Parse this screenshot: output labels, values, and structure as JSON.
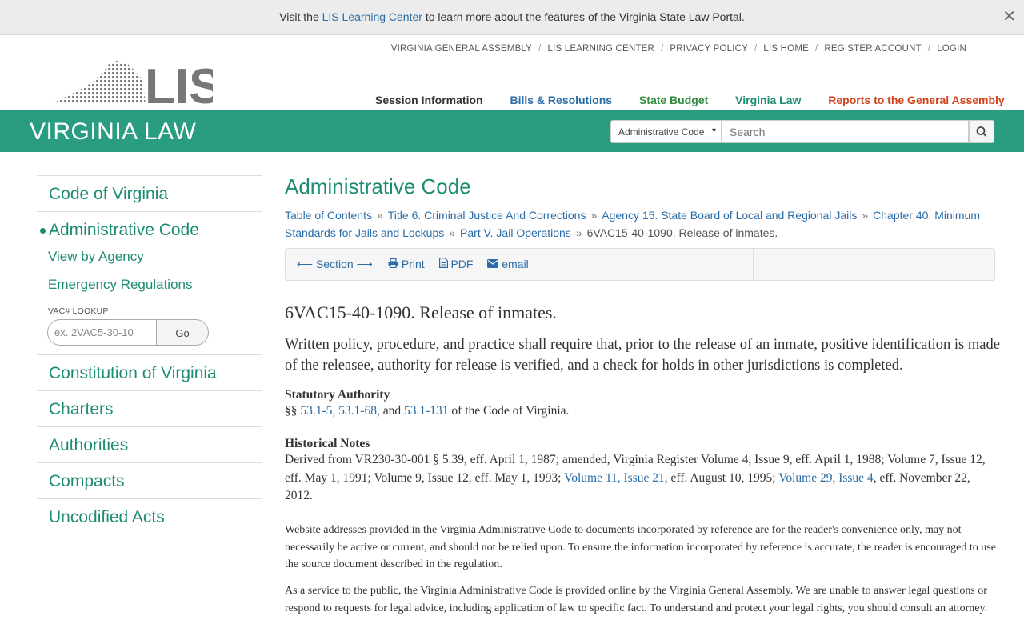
{
  "notice": {
    "prefix": "Visit the",
    "link": "LIS Learning Center",
    "suffix": "to learn more about the features of the Virginia State Law Portal.",
    "close": "✕"
  },
  "utility_links": [
    "VIRGINIA GENERAL ASSEMBLY",
    "LIS LEARNING CENTER",
    "PRIVACY POLICY",
    "LIS HOME",
    "REGISTER ACCOUNT",
    "LOGIN"
  ],
  "logo": {
    "text": "LIS"
  },
  "main_nav": {
    "session": "Session Information",
    "bills": "Bills & Resolutions",
    "budget": "State Budget",
    "law": "Virginia Law",
    "reports": "Reports to the General Assembly"
  },
  "header": {
    "title": "VIRGINIA LAW",
    "search_scope": "Administrative Code",
    "search_placeholder": "Search"
  },
  "sidebar": {
    "code_of_virginia": "Code of Virginia",
    "administrative_code": "Administrative Code",
    "view_by_agency": "View by Agency",
    "emergency_regulations": "Emergency Regulations",
    "vac_lookup_label": "VAC# LOOKUP",
    "vac_lookup_placeholder": "ex. 2VAC5-30-10",
    "vac_go": "Go",
    "constitution": "Constitution of Virginia",
    "charters": "Charters",
    "authorities": "Authorities",
    "compacts": "Compacts",
    "uncodified_acts": "Uncodified Acts"
  },
  "content": {
    "title": "Administrative Code",
    "breadcrumb": {
      "toc": "Table of Contents",
      "title6": "Title 6. Criminal Justice And Corrections",
      "agency15": "Agency 15. State Board of Local and Regional Jails",
      "chapter40": "Chapter 40. Minimum Standards for Jails and Lockups",
      "part5": "Part V. Jail Operations",
      "current": "6VAC15-40-1090. Release of inmates.",
      "sep": "»"
    },
    "toolbar": {
      "section": "Section",
      "print": "Print",
      "pdf": "PDF",
      "email": "email"
    },
    "regulation_title": "6VAC15-40-1090. Release of inmates.",
    "regulation_body": "Written policy, procedure, and practice shall require that, prior to the release of an inmate, positive identification is made of the releasee, authority for release is verified, and a check for holds in other jurisdictions is completed.",
    "statutory": {
      "heading": "Statutory Authority",
      "prefix": "§§",
      "link1": "53.1-5",
      "comma": ",",
      "link2": "53.1-68",
      "and": ", and",
      "link3": "53.1-131",
      "suffix": "of the Code of Virginia."
    },
    "historical": {
      "heading": "Historical Notes",
      "text1": "Derived from VR230-30-001 § 5.39, eff. April 1, 1987; amended, Virginia Register Volume 4, Issue 9, eff. April 1, 1988; Volume 7, Issue 12, eff. May 1, 1991; Volume 9, Issue 12, eff. May 1, 1993;",
      "link1": "Volume 11, Issue 21",
      "text2": ", eff. August 10, 1995;",
      "link2": "Volume 29, Issue 4",
      "text3": ", eff. November 22, 2012."
    },
    "note1": "Website addresses provided in the Virginia Administrative Code to documents incorporated by reference are for the reader's convenience only, may not necessarily be active or current, and should not be relied upon. To ensure the information incorporated by reference is accurate, the reader is encouraged to use the source document described in the regulation.",
    "note2": "As a service to the public, the Virginia Administrative Code is provided online by the Virginia General Assembly. We are unable to answer legal questions or respond to requests for legal advice, including application of law to specific fact. To understand and protect your legal rights, you should consult an attorney."
  }
}
